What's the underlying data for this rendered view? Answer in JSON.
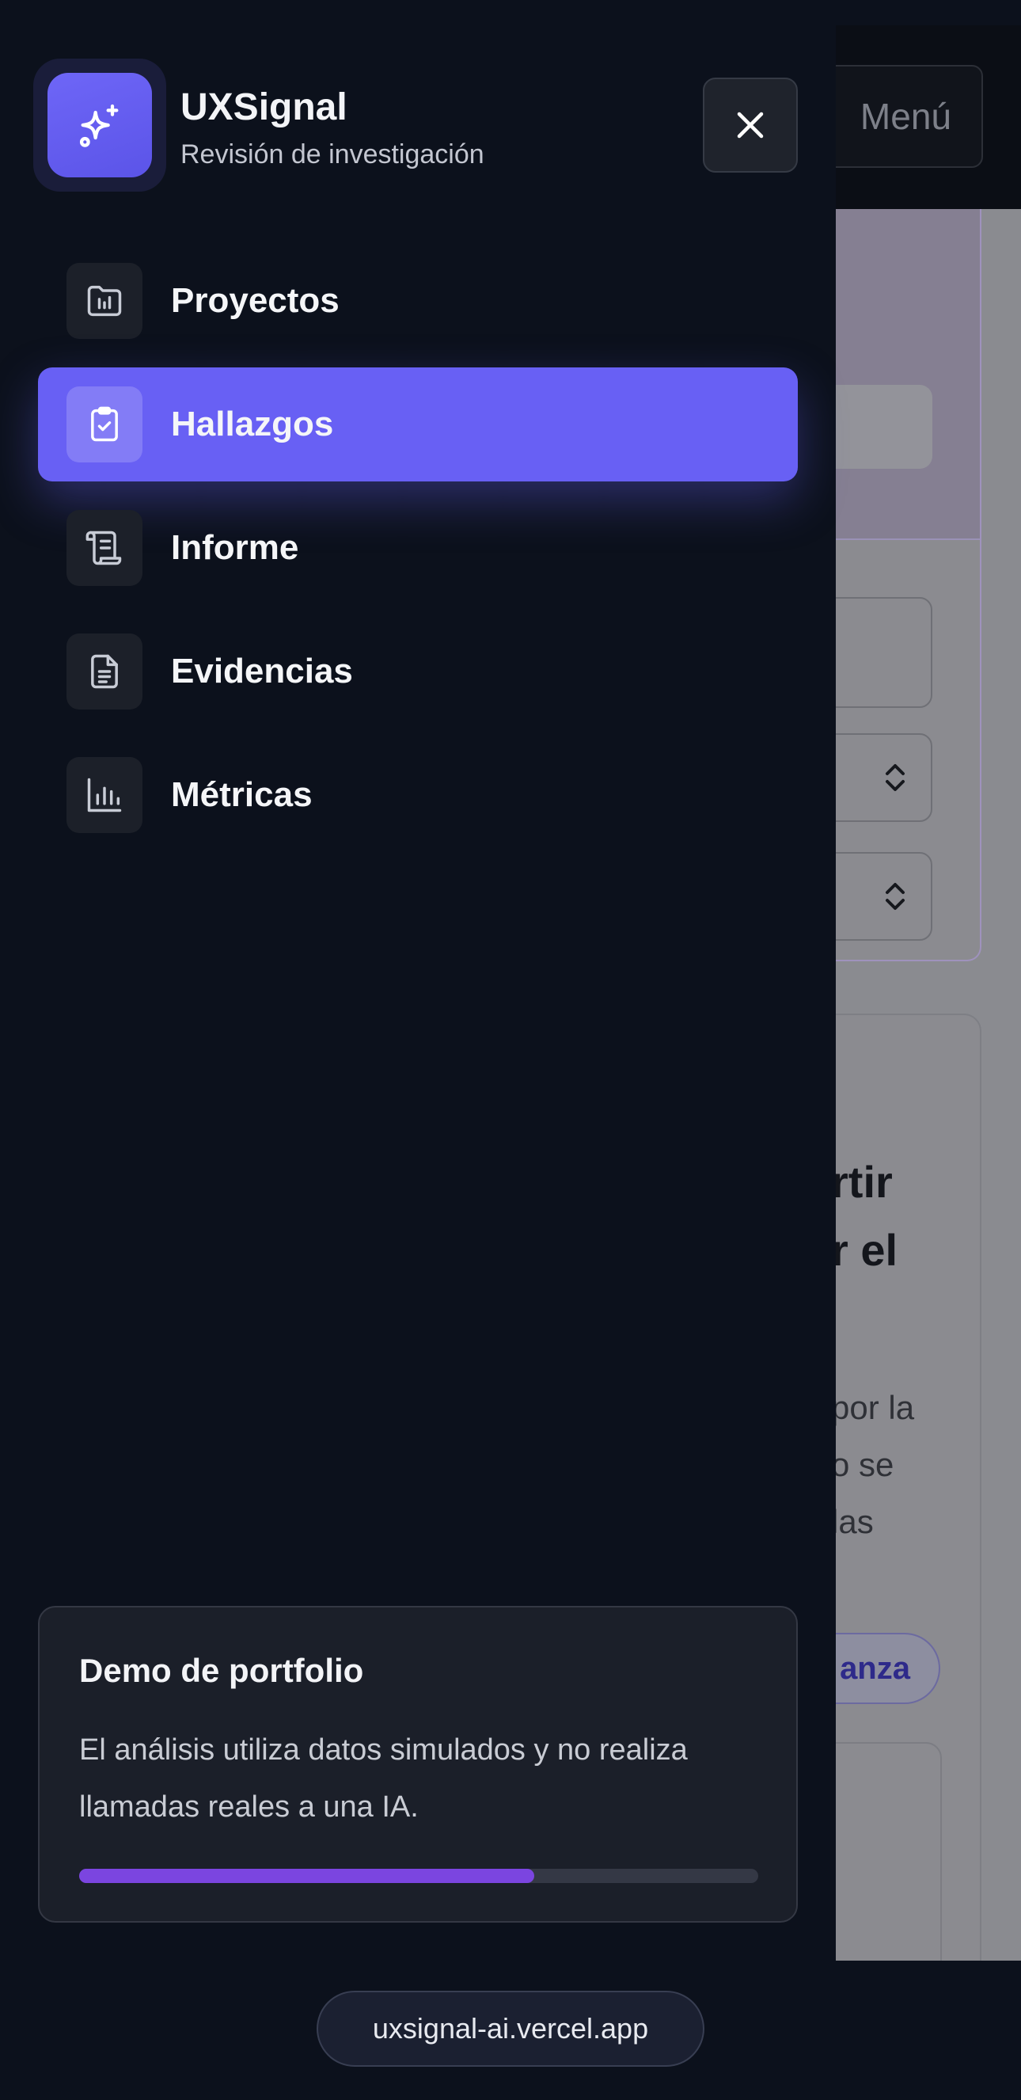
{
  "background": {
    "menu_button_label": "Menú",
    "heading_fragment": "rtir\nr el",
    "paragraph_fragment": "por la\no se\nlas",
    "badge_fragment": "anza"
  },
  "drawer": {
    "brand": {
      "name": "UXSignal",
      "subtitle": "Revisión de investigación",
      "logo_icon": "sparkles-icon"
    },
    "close_icon": "close-icon",
    "nav": [
      {
        "label": "Proyectos",
        "icon": "folder-chart-icon",
        "active": false
      },
      {
        "label": "Hallazgos",
        "icon": "clipboard-check-icon",
        "active": true
      },
      {
        "label": "Informe",
        "icon": "scroll-icon",
        "active": false
      },
      {
        "label": "Evidencias",
        "icon": "document-icon",
        "active": false
      },
      {
        "label": "Métricas",
        "icon": "bar-chart-icon",
        "active": false
      }
    ],
    "demo_card": {
      "title": "Demo de portfolio",
      "text": "El análisis utiliza datos simulados y no realiza llamadas reales a una IA.",
      "progress": 0.67
    }
  },
  "footer": {
    "url": "uxsignal-ai.vercel.app"
  },
  "colors": {
    "accent": "#6860f4",
    "progress": "#7b45e0",
    "drawer_bg": "#0c111c"
  }
}
